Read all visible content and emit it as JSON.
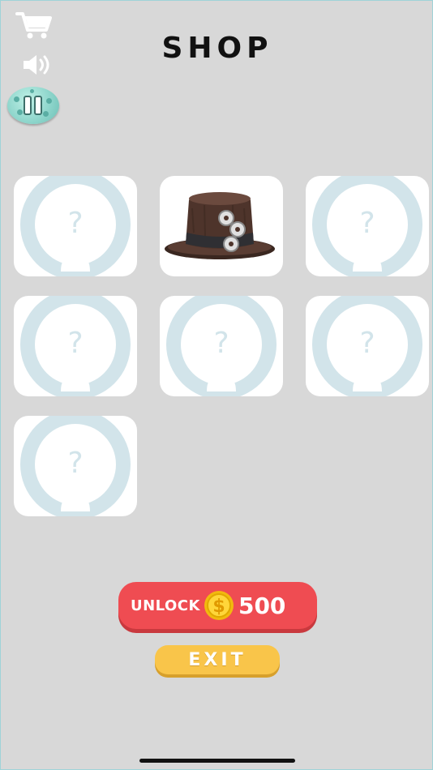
{
  "screen": {
    "title": "SHOP"
  },
  "top_controls": {
    "icons": [
      "cart-icon",
      "speaker-icon",
      "pause-icon"
    ]
  },
  "items": [
    {
      "state": "locked",
      "symbol": "?"
    },
    {
      "state": "unlocked",
      "item": "top-hat-with-gears"
    },
    {
      "state": "locked",
      "symbol": "?"
    },
    {
      "state": "locked",
      "symbol": "?"
    },
    {
      "state": "locked",
      "symbol": "?"
    },
    {
      "state": "locked",
      "symbol": "?"
    },
    {
      "state": "locked",
      "symbol": "?"
    }
  ],
  "unlock": {
    "label": "UNLOCK",
    "price": "500",
    "icon": "coin-icon"
  },
  "exit": {
    "label": "EXIT"
  },
  "colors": {
    "background": "#d8d8d8",
    "unlock_button": "#ef4c52",
    "exit_button": "#f9c54a",
    "locked_silhouette": "#d2e4ea"
  }
}
